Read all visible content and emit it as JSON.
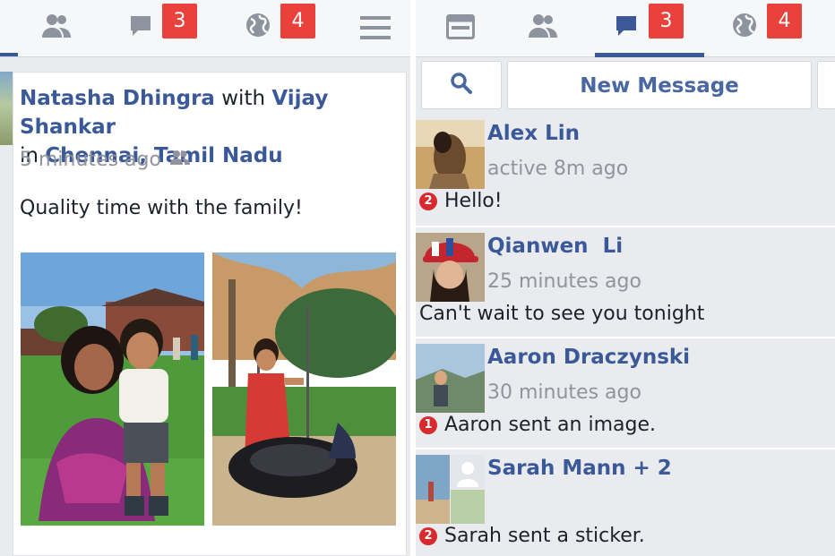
{
  "left": {
    "topbar": {
      "messages_badge": "3",
      "notifications_badge": "4"
    },
    "post": {
      "author": "Natasha Dhingra",
      "with_word": "with",
      "tagged": "Vijay Shankar",
      "in_word": "in",
      "location": "Chennai, Tamil Nadu",
      "time": "5 minutes ago",
      "audience_icon": "friends-icon",
      "text": "Quality time with the family!"
    }
  },
  "right": {
    "topbar": {
      "messages_badge": "3",
      "notifications_badge": "4"
    },
    "new_message_label": "New Message",
    "threads": [
      {
        "name": "Alex Lin",
        "time": "active 8m ago",
        "count": "2",
        "message": "Hello!"
      },
      {
        "name": "Qianwen  Li",
        "time": "25 minutes ago",
        "count": "",
        "message": "Can't wait to see you tonight"
      },
      {
        "name": "Aaron Draczynski",
        "time": "30 minutes ago",
        "count": "1",
        "message": "Aaron sent an image."
      },
      {
        "name": "Sarah Mann + 2",
        "time": "",
        "count": "2",
        "message": "Sarah sent a sticker."
      }
    ]
  },
  "colors": {
    "brand": "#3b5998",
    "badge": "#e9413b",
    "muted": "#90949c"
  }
}
